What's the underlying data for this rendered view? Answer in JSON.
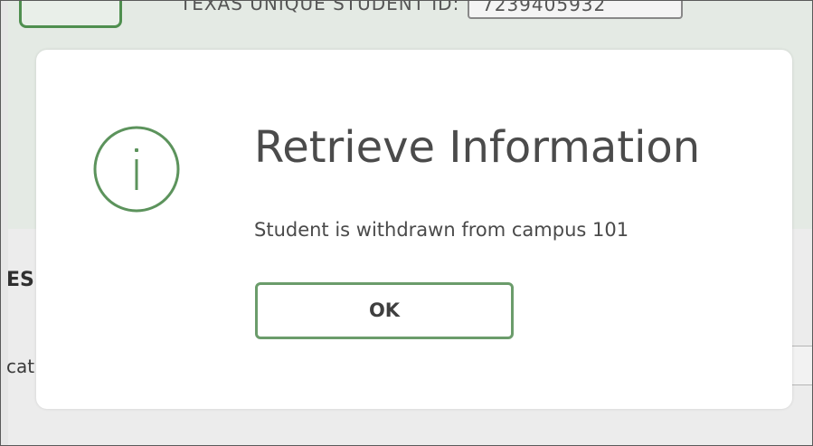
{
  "background": {
    "field_label": "TEXAS UNIQUE STUDENT ID:",
    "field_value": "7239405932",
    "section_title": "ES",
    "row_label": "cati"
  },
  "modal": {
    "icon": "info-circle-icon",
    "title": "Retrieve Information",
    "message": "Student is withdrawn from campus 101",
    "ok_label": "OK"
  },
  "colors": {
    "accent": "#5c935c",
    "button_border": "#6b9c6b",
    "title_text": "#4b4b4b",
    "overlay": "#e4eae4"
  }
}
